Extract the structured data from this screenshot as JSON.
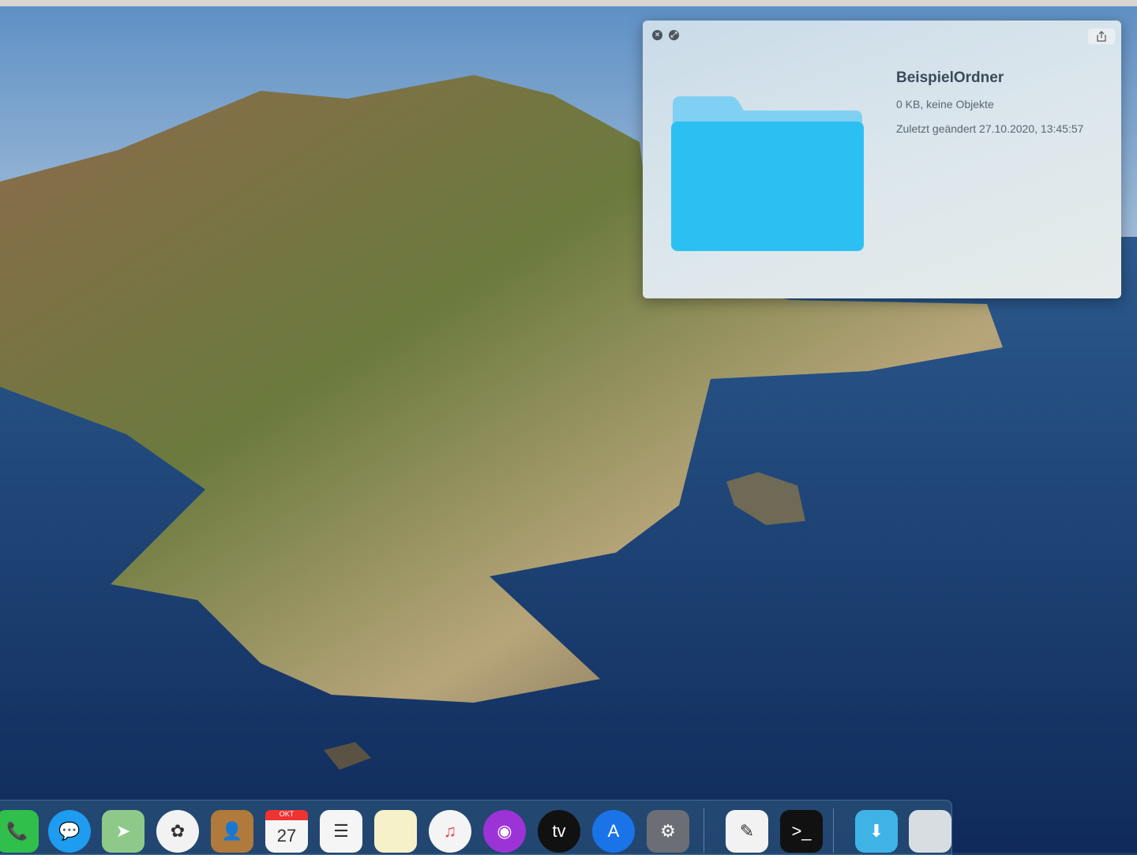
{
  "quicklook": {
    "title": "BeispielOrdner",
    "size": "0 KB, keine Objekte",
    "modified": "Zuletzt geändert 27.10.2020, 13:45:57"
  },
  "dock": {
    "items": [
      {
        "name": "facetime",
        "glyph": "📞",
        "color": "#2fbf4a"
      },
      {
        "name": "messages",
        "glyph": "💬",
        "color": "#1e9cf0"
      },
      {
        "name": "maps",
        "glyph": "➤",
        "color": "#8fc98a"
      },
      {
        "name": "photos",
        "glyph": "✿",
        "color": "#f2f2f2"
      },
      {
        "name": "contacts",
        "glyph": "👤",
        "color": "#b07a3c"
      },
      {
        "name": "calendar",
        "glyph": "27",
        "color": "#f5f5f5"
      },
      {
        "name": "reminders",
        "glyph": "☰",
        "color": "#f5f5f5"
      },
      {
        "name": "notes",
        "glyph": "",
        "color": "#f6f1c9"
      },
      {
        "name": "music",
        "glyph": "♫",
        "color": "#f4f4f4"
      },
      {
        "name": "podcasts",
        "glyph": "◉",
        "color": "#9b33d6"
      },
      {
        "name": "apple-tv",
        "glyph": "tv",
        "color": "#111111"
      },
      {
        "name": "app-store",
        "glyph": "A",
        "color": "#1a74e8"
      },
      {
        "name": "system-preferences",
        "glyph": "⚙",
        "color": "#6b6f75"
      },
      {
        "name": "textedit",
        "glyph": "✎",
        "color": "#f2f2f2"
      },
      {
        "name": "terminal",
        "glyph": ">_",
        "color": "#111111"
      },
      {
        "name": "downloads",
        "glyph": "⬇",
        "color": "#3fb3e6"
      },
      {
        "name": "trash",
        "glyph": "",
        "color": "#d8dde2"
      }
    ],
    "calendar_month": "OKT"
  }
}
